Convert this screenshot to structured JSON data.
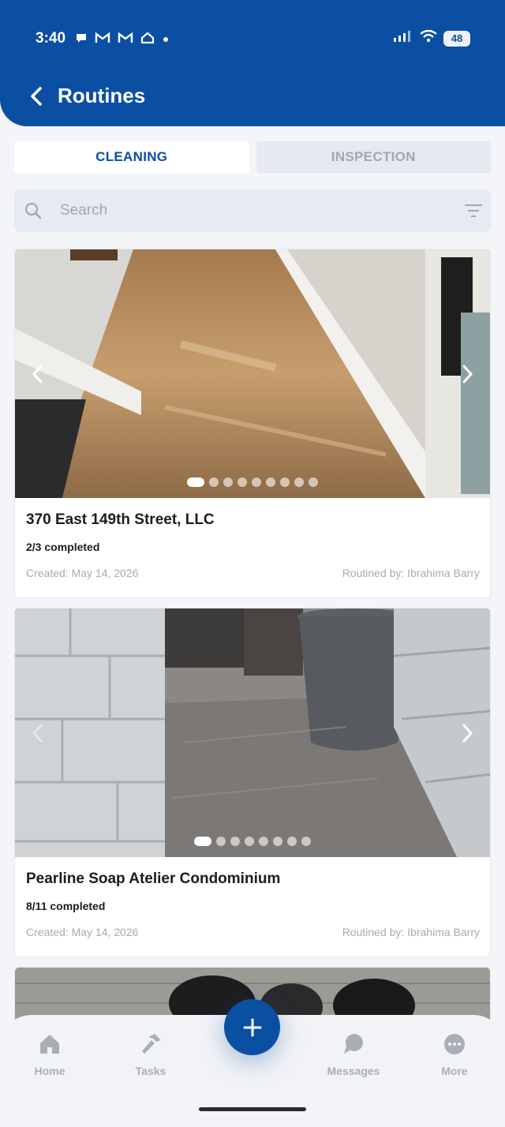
{
  "status_bar": {
    "time": "3:40",
    "battery": "48"
  },
  "header": {
    "title": "Routines"
  },
  "tabs": [
    {
      "label": "CLEANING",
      "active": true
    },
    {
      "label": "INSPECTION",
      "active": false
    }
  ],
  "search": {
    "placeholder": "Search",
    "value": ""
  },
  "cards": [
    {
      "title": "370 East 149th Street, LLC",
      "progress": "2/3 completed",
      "created": "Created: May 14, 2026",
      "routined_by": "Routined by: Ibrahima Barry",
      "photo_count": 9,
      "photo_index": 1
    },
    {
      "title": "Pearline Soap Atelier Condominium",
      "progress": "8/11 completed",
      "created": "Created: May 14, 2026",
      "routined_by": "Routined by: Ibrahima Barry",
      "photo_count": 8,
      "photo_index": 1
    }
  ],
  "bottom_nav": [
    {
      "label": "Home",
      "icon": "home-icon"
    },
    {
      "label": "Tasks",
      "icon": "hammer-icon"
    },
    {
      "label": "Messages",
      "icon": "chat-icon"
    },
    {
      "label": "More",
      "icon": "more-icon"
    }
  ],
  "colors": {
    "primary": "#0b4fa3",
    "background": "#f3f5f9",
    "muted": "#a6abb3"
  }
}
